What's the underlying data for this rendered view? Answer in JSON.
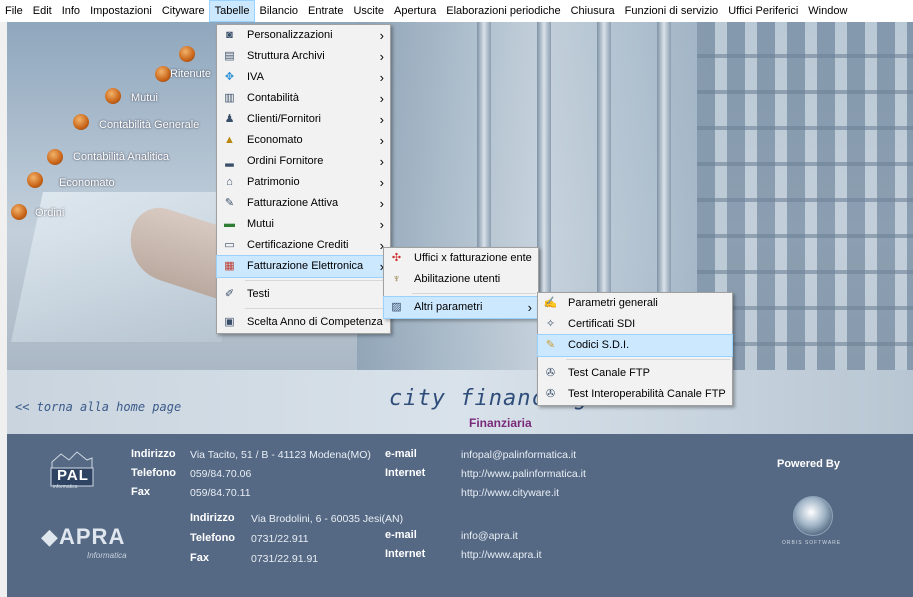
{
  "menubar": [
    "File",
    "Edit",
    "Info",
    "Impostazioni",
    "Cityware",
    "Tabelle",
    "Bilancio",
    "Entrate",
    "Uscite",
    "Apertura",
    "Elaborazioni periodiche",
    "Chiusura",
    "Funzioni di servizio",
    "Uffici Periferici",
    "Window"
  ],
  "nav": {
    "items": [
      "Ritenute",
      "Mutui",
      "Contabilità Generale",
      "Contabilità Analitica",
      "Economato",
      "Ordini"
    ],
    "home_link": "<< torna alla home page"
  },
  "brand": {
    "title": "city financing",
    "subtitle": "Finanziaria"
  },
  "tabelle_menu": [
    {
      "label": "Personalizzazioni",
      "icon": "personalization-icon",
      "submenu": true
    },
    {
      "label": "Struttura Archivi",
      "icon": "archive-structure-icon",
      "submenu": true
    },
    {
      "label": "IVA",
      "icon": "vat-icon",
      "submenu": true
    },
    {
      "label": "Contabilità",
      "icon": "accounting-icon",
      "submenu": true
    },
    {
      "label": "Clienti/Fornitori",
      "icon": "customers-suppliers-icon",
      "submenu": true
    },
    {
      "label": "Economato",
      "icon": "economato-icon",
      "submenu": true
    },
    {
      "label": "Ordini Fornitore",
      "icon": "supplier-orders-icon",
      "submenu": true
    },
    {
      "label": "Patrimonio",
      "icon": "assets-icon",
      "submenu": true
    },
    {
      "label": "Fatturazione Attiva",
      "icon": "invoicing-icon",
      "submenu": true
    },
    {
      "label": "Mutui",
      "icon": "loans-icon",
      "submenu": true
    },
    {
      "label": "Certificazione Crediti",
      "icon": "credit-certification-icon",
      "submenu": true
    },
    {
      "label": "Fatturazione Elettronica",
      "icon": "e-invoicing-icon",
      "submenu": true,
      "selected": true
    },
    {
      "separator": true
    },
    {
      "label": "Testi",
      "icon": "texts-icon",
      "submenu": false
    },
    {
      "separator": true
    },
    {
      "label": "Scelta Anno di Competenza",
      "icon": "year-choice-icon",
      "submenu": false
    }
  ],
  "fe_submenu": [
    {
      "label": "Uffici x fatturazione ente",
      "icon": "offices-icon",
      "submenu": false
    },
    {
      "label": "Abilitazione utenti",
      "icon": "users-enable-icon",
      "submenu": false
    },
    {
      "separator": true
    },
    {
      "label": "Altri parametri",
      "icon": "parameters-icon",
      "submenu": true,
      "selected": true
    }
  ],
  "altri_submenu": [
    {
      "label": "Parametri generali",
      "icon": "general-params-icon"
    },
    {
      "label": "Certificati SDI",
      "icon": "certificates-icon"
    },
    {
      "label": "Codici S.D.I.",
      "icon": "sdi-codes-icon",
      "selected": true
    },
    {
      "separator": true
    },
    {
      "label": "Test Canale FTP",
      "icon": "ftp-test-icon"
    },
    {
      "label": "Test Interoperabilità Canale FTP",
      "icon": "ftp-interop-icon"
    }
  ],
  "footer": {
    "pal": {
      "address_label": "Indirizzo",
      "address": "Via Tacito, 51 / B - 41123 Modena(MO)",
      "phone_label": "Telefono",
      "phone": "059/84.70.06",
      "fax_label": "Fax",
      "fax": "059/84.70.11",
      "email_label": "e-mail",
      "email": "infopal@palinformatica.it",
      "internet_label": "Internet",
      "internet": "http://www.palinformatica.it",
      "internet2": "http://www.cityware.it",
      "logo": "PAL",
      "logo_sub": "informatica"
    },
    "apra": {
      "address_label": "Indirizzo",
      "address": "Via Brodolini, 6 - 60035 Jesi(AN)",
      "phone_label": "Telefono",
      "phone": "0731/22.911",
      "fax_label": "Fax",
      "fax": "0731/22.91.91",
      "email_label": "e-mail",
      "email": "info@apra.it",
      "internet_label": "Internet",
      "internet": "http://www.apra.it",
      "logo": "APRA",
      "logo_sub": "Informatica"
    },
    "powered_by": "Powered By",
    "orbit_text": "ORBIS SOFTWARE"
  }
}
